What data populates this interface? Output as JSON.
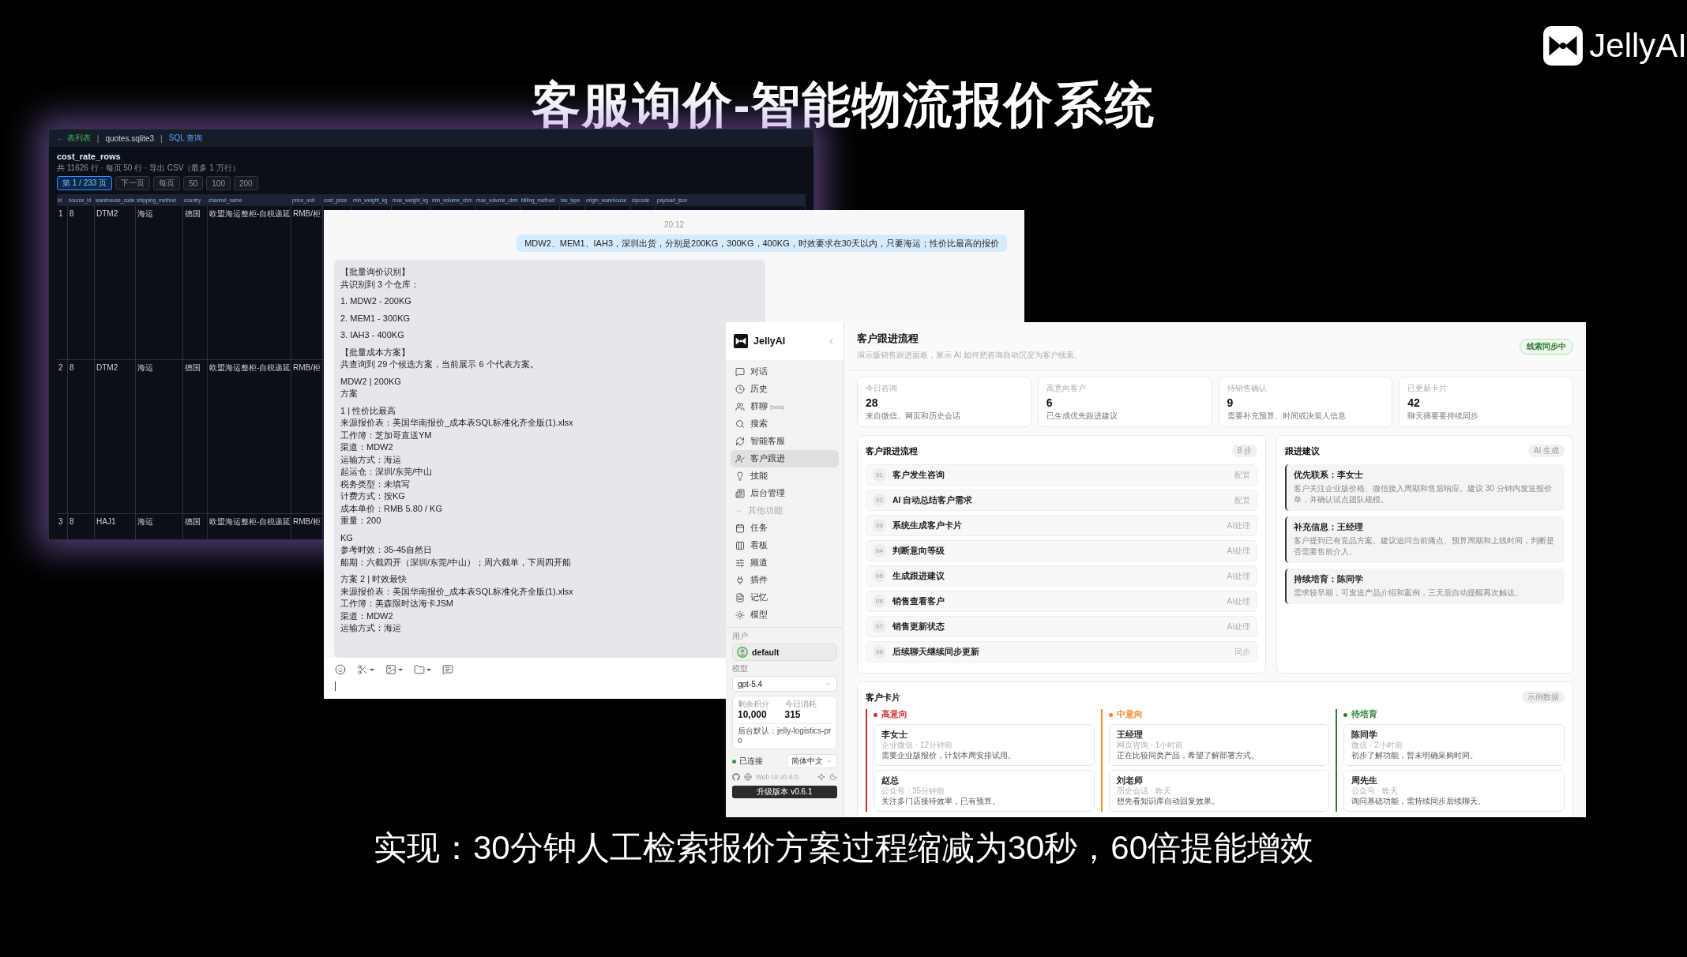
{
  "slide": {
    "title": "客服询价-智能物流报价系统",
    "brand": "JellyAI",
    "caption": "实现：30分钟人工检索报价方案过程缩减为30秒，60倍提能增效"
  },
  "db_window": {
    "topbar": [
      {
        "text": "← 表列表",
        "kind": "back"
      },
      {
        "text": "|",
        "kind": "sep"
      },
      {
        "text": "quotes.sqlite3",
        "kind": "file"
      },
      {
        "text": "|",
        "kind": "sep"
      },
      {
        "text": "SQL 查询",
        "kind": "link"
      }
    ],
    "table_name": "cost_rate_rows",
    "summary": "共 11626 行 · 每页 50 行 · 导出 CSV（最多 1 万行）",
    "pager": [
      {
        "label": "第 1 / 233 页",
        "selected": true
      },
      {
        "label": "下一页",
        "selected": false
      },
      {
        "label": "每页",
        "selected": false
      },
      {
        "label": "50",
        "selected": false
      },
      {
        "label": "100",
        "selected": false
      },
      {
        "label": "200",
        "selected": false
      }
    ],
    "columns": [
      "id",
      "source_id",
      "warehouse_code",
      "shipping_method",
      "country",
      "channel_name",
      "price_unit",
      "cost_price",
      "min_weight_kg",
      "max_weight_kg",
      "min_volume_cbm",
      "max_volume_cbm",
      "billing_method",
      "tax_type",
      "origin_warehouse",
      "zipcode",
      "payload_json"
    ],
    "rows": [
      [
        "1",
        "8",
        "DTM2",
        "海运",
        "德国",
        "欧盟海运整柜-自税递延",
        "RMB/柜"
      ],
      [
        "2",
        "8",
        "DTM2",
        "海运",
        "德国",
        "欧盟海运整柜-自税递延",
        "RMB/柜"
      ],
      [
        "3",
        "8",
        "HAJ1",
        "海运",
        "德国",
        "欧盟海运整柜-自税递延",
        "RMB/柜"
      ]
    ]
  },
  "chat": {
    "time": "20:12",
    "user_message": "MDW2、MEM1、IAH3，深圳出货，分别是200KG，300KG，400KG，时效要求在30天以内，只要海运；性价比最高的报价",
    "bot_paragraphs": [
      [
        "【批量询价识别】",
        "共识别到 3 个仓库："
      ],
      [
        "1. MDW2 - 200KG"
      ],
      [
        "2. MEM1 - 300KG"
      ],
      [
        "3. IAH3 - 400KG"
      ],
      [
        "【批量成本方案】",
        "共查询到 29 个候选方案，当前展示 6 个代表方案。"
      ],
      [
        "MDW2 | 200KG",
        "方案"
      ],
      [
        "1 | 性价比最高",
        "来源报价表：美国华南报价_成本表SQL标准化齐全版(1).xlsx",
        "工作簿：芝加哥直送YM",
        "渠道：MDW2",
        "运输方式：海运",
        "起运仓：深圳/东莞/中山",
        "税务类型：未填写",
        "计费方式：按KG",
        "成本单价：RMB 5.80 / KG",
        "重量：200"
      ],
      [
        "KG",
        "参考时效：35-45自然日",
        "船期：六截四开（深圳/东莞/中山）；周六截单，下周四开船"
      ],
      [
        "方案 2 | 时效最快",
        "来源报价表：美国华南报价_成本表SQL标准化齐全版(1).xlsx",
        "工作簿：美森限时达海卡JSM",
        "渠道：MDW2",
        "运输方式：海运"
      ]
    ],
    "tools": [
      {
        "kind": "emoji",
        "menu": false
      },
      {
        "kind": "cut",
        "menu": true
      },
      {
        "kind": "image",
        "menu": true
      },
      {
        "kind": "folder",
        "menu": true
      },
      {
        "kind": "screen",
        "menu": false
      }
    ]
  },
  "app": {
    "sidebar": {
      "brand": "JellyAI",
      "nav": [
        {
          "kind": "item",
          "label": "对话",
          "selected": false
        },
        {
          "kind": "item",
          "label": "历史",
          "selected": false
        },
        {
          "kind": "item",
          "label": "群聊",
          "tag": "(beta)",
          "selected": false
        },
        {
          "kind": "item",
          "label": "搜索",
          "selected": false
        },
        {
          "kind": "item",
          "label": "智能客服",
          "selected": false
        },
        {
          "kind": "item",
          "label": "客户跟进",
          "selected": true
        },
        {
          "kind": "item",
          "label": "技能",
          "selected": false
        },
        {
          "kind": "item",
          "label": "后台管理",
          "selected": false
        },
        {
          "kind": "section",
          "label": "其他功能"
        },
        {
          "kind": "item",
          "label": "任务",
          "selected": false
        },
        {
          "kind": "item",
          "label": "看板",
          "selected": false
        },
        {
          "kind": "item",
          "label": "频道",
          "selected": false
        },
        {
          "kind": "item",
          "label": "插件",
          "selected": false
        },
        {
          "kind": "item",
          "label": "记忆",
          "selected": false
        },
        {
          "kind": "item",
          "label": "模型",
          "selected": false
        }
      ],
      "user_label": "用户",
      "user": "default",
      "model_label": "模型",
      "model": "gpt-5.4",
      "credits": [
        {
          "label": "剩余积分",
          "value": "10,000"
        },
        {
          "label": "今日消耗",
          "value": "315"
        }
      ],
      "backend": "后台默认：jelly-logistics-pro",
      "status": {
        "label": "已连接",
        "connected": true
      },
      "language": "简体中文",
      "version": "Web UI v0.6.0",
      "upgrade": "升级版本 v0.6.1"
    },
    "main": {
      "title": "客户跟进流程",
      "subtitle": "演示版销售跟进面板，展示 AI 如何把咨询自动沉淀为客户线索。",
      "badge": "线索同步中",
      "stats": [
        {
          "label": "今日咨询",
          "value": "28",
          "note": "来自微信、网页和历史会话"
        },
        {
          "label": "高意向客户",
          "value": "6",
          "note": "已生成优先跟进建议"
        },
        {
          "label": "待销售确认",
          "value": "9",
          "note": "需要补充预算、时间或决策人信息"
        },
        {
          "label": "已更新卡片",
          "value": "42",
          "note": "聊天摘要要持续同步"
        }
      ],
      "flow": {
        "title": "客户跟进流程",
        "badge": "8 步",
        "steps": [
          {
            "num": "01",
            "title": "客户发生咨询",
            "tag": "配置"
          },
          {
            "num": "02",
            "title": "AI 自动总结客户需求",
            "tag": "配置"
          },
          {
            "num": "03",
            "title": "系统生成客户卡片",
            "tag": "AI处理"
          },
          {
            "num": "04",
            "title": "判断意向等级",
            "tag": "AI处理"
          },
          {
            "num": "05",
            "title": "生成跟进建议",
            "tag": "AI处理"
          },
          {
            "num": "06",
            "title": "销售查看客户",
            "tag": "AI处理"
          },
          {
            "num": "07",
            "title": "销售更新状态",
            "tag": "AI处理"
          },
          {
            "num": "08",
            "title": "后续聊天继续同步更新",
            "tag": "同步"
          }
        ]
      },
      "suggestions": {
        "title": "跟进建议",
        "badge": "AI 生成",
        "items": [
          {
            "title": "优先联系：李女士",
            "text": "客户关注企业版价格、微信接入周期和售后响应。建议 30 分钟内发送报价单，并确认试点团队规模。"
          },
          {
            "title": "补充信息：王经理",
            "text": "客户提到已有竞品方案。建议追问当前痛点、预算周期和上线时间，判断是否需要售前介入。"
          },
          {
            "title": "持续培育：陈同学",
            "text": "需求较早期，可发送产品介绍和案例，三天后自动提醒再次触达。"
          }
        ]
      },
      "cards": {
        "title": "客户卡片",
        "badge": "示例数据",
        "columns": [
          {
            "label": "高意向",
            "color": "#d32f2f",
            "cards": [
              {
                "name": "李女士",
                "meta": "企业微信 · 12分钟前",
                "text": "需要企业版报价，计划本周安排试用。"
              },
              {
                "name": "赵总",
                "meta": "公众号 · 35分钟前",
                "text": "关注多门店接待效率，已有预算。"
              }
            ]
          },
          {
            "label": "中意向",
            "color": "#f08a24",
            "cards": [
              {
                "name": "王经理",
                "meta": "网页咨询 · 1小时前",
                "text": "正在比较同类产品，希望了解部署方式。"
              },
              {
                "name": "刘老师",
                "meta": "历史会话 · 昨天",
                "text": "想先看知识库自动回复效果。"
              }
            ]
          },
          {
            "label": "待培育",
            "color": "#2e7d32",
            "cards": [
              {
                "name": "陈同学",
                "meta": "微信 · 2小时前",
                "text": "初步了解功能，暂未明确采购时间。"
              },
              {
                "name": "周先生",
                "meta": "公众号 · 昨天",
                "text": "询问基础功能，需持续同步后续聊天。"
              }
            ]
          }
        ]
      }
    }
  }
}
